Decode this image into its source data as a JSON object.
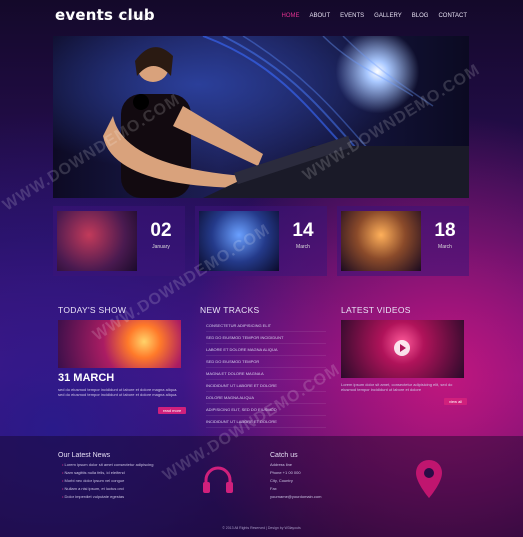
{
  "header": {
    "logo": "events club",
    "nav": [
      "HOME",
      "ABOUT",
      "EVENTS",
      "GALLERY",
      "BLOG",
      "CONTACT"
    ],
    "active": "HOME",
    "accent_color": "#e0318f"
  },
  "events": [
    {
      "day": "02",
      "month": "January"
    },
    {
      "day": "14",
      "month": "March"
    },
    {
      "day": "18",
      "month": "March"
    }
  ],
  "todays_show": {
    "title": "TODAY'S SHOW",
    "date": "31 MARCH",
    "text": "sed do eiusmod tempor incididunt ut labore et dolore magna aliqua. sed do eiusmod tempor incididunt ut labore et dolore magna aliqua.",
    "button": "read more"
  },
  "new_tracks": {
    "title": "NEW TRACKS",
    "items": [
      "consectetur adipisicing elit",
      "sed do eiusmod tempor incididunt",
      "labore et dolore magna aliqua",
      "sed do eiusmod tempor",
      "magna et dolore magna a",
      "incididunt ut labore et dolore",
      "dolore magna aliqua",
      "adipisicing elit, sed do eiusmod",
      "incididunt ut labore et dolore"
    ]
  },
  "latest_videos": {
    "title": "LATEST VIDEOS",
    "text": "Lorem ipsum dolor sit amet, consectetur adipisicing elit, sed do eiusmod tempor incididunt ut labore et dolore",
    "button": "view all"
  },
  "footer": {
    "news_title": "Our Latest News",
    "news_items": [
      "Lorem ipsum dolor sit amet consectetur adipiscing",
      "Nam sagittis nulla felis, id eleifend",
      "Morbi nec dolor ipsum vel congue",
      "Nullam a nisi ipsum, et luctus orci",
      "Dolor imperdiet vulputate egestas"
    ],
    "catch_title": "Catch us",
    "contact_items": [
      "Address line",
      "Phone +1 00 000",
      "City, Country",
      "Fax",
      "yourname@yourdomain.com"
    ],
    "copyright": "© 2013 All Rights Reserved | Design by W3layouts"
  },
  "watermark": "WWW.DOWNDEMO.COM"
}
